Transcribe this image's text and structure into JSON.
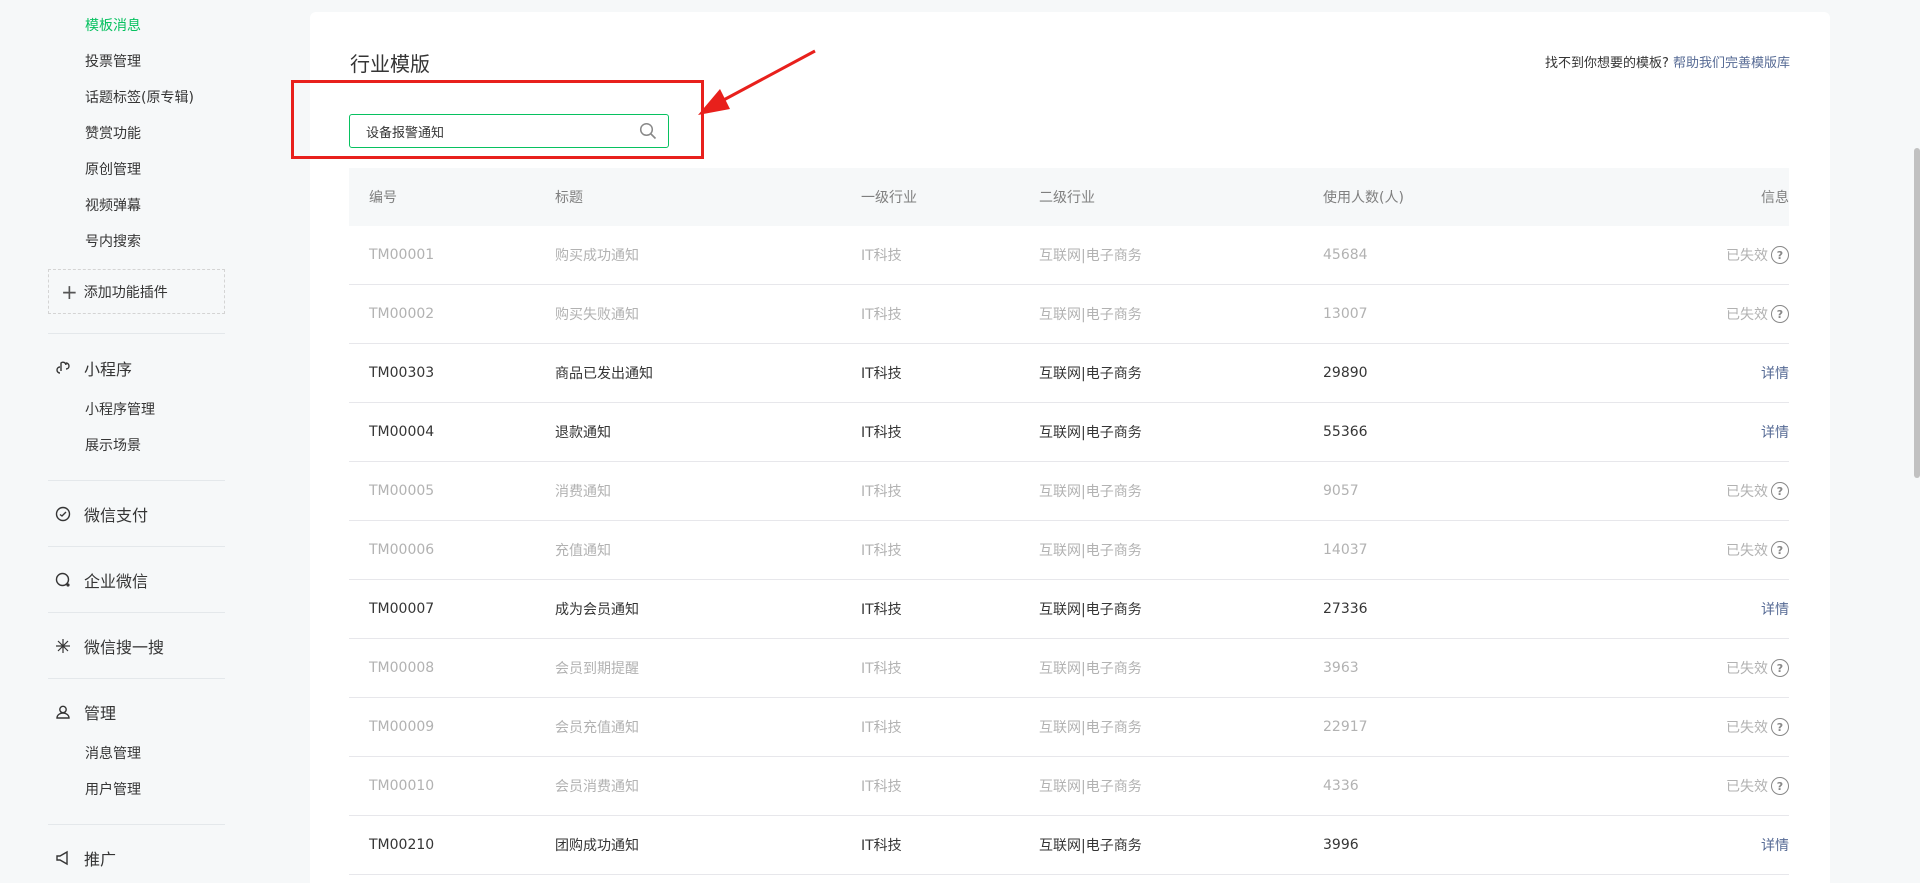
{
  "sidebar": {
    "top_items": [
      "模板消息",
      "投票管理",
      "话题标签(原专辑)",
      "赞赏功能",
      "原创管理",
      "视频弹幕",
      "号内搜索"
    ],
    "add_plugin": "添加功能插件",
    "mini_program": {
      "title": "小程序",
      "items": [
        "小程序管理",
        "展示场景"
      ]
    },
    "wechat_pay": {
      "title": "微信支付"
    },
    "work_wechat": {
      "title": "企业微信"
    },
    "wechat_search": {
      "title": "微信搜一搜"
    },
    "manage": {
      "title": "管理",
      "items": [
        "消息管理",
        "用户管理"
      ]
    },
    "promote": {
      "title": "推广"
    }
  },
  "main": {
    "title": "行业模版",
    "help_prefix": "找不到你想要的模板?",
    "help_link": "帮助我们完善模版库",
    "search_value": "设备报警通知"
  },
  "table": {
    "headers": [
      "编号",
      "标题",
      "一级行业",
      "二级行业",
      "使用人数(人)",
      "信息"
    ],
    "rows": [
      {
        "id": "TM00001",
        "title": "购买成功通知",
        "ind1": "IT科技",
        "ind2": "互联网|电子商务",
        "users": "45684",
        "info": "已失效"
      },
      {
        "id": "TM00002",
        "title": "购买失败通知",
        "ind1": "IT科技",
        "ind2": "互联网|电子商务",
        "users": "13007",
        "info": "已失效"
      },
      {
        "id": "TM00303",
        "title": "商品已发出通知",
        "ind1": "IT科技",
        "ind2": "互联网|电子商务",
        "users": "29890",
        "info": "详情"
      },
      {
        "id": "TM00004",
        "title": "退款通知",
        "ind1": "IT科技",
        "ind2": "互联网|电子商务",
        "users": "55366",
        "info": "详情"
      },
      {
        "id": "TM00005",
        "title": "消费通知",
        "ind1": "IT科技",
        "ind2": "互联网|电子商务",
        "users": "9057",
        "info": "已失效"
      },
      {
        "id": "TM00006",
        "title": "充值通知",
        "ind1": "IT科技",
        "ind2": "互联网|电子商务",
        "users": "14037",
        "info": "已失效"
      },
      {
        "id": "TM00007",
        "title": "成为会员通知",
        "ind1": "IT科技",
        "ind2": "互联网|电子商务",
        "users": "27336",
        "info": "详情"
      },
      {
        "id": "TM00008",
        "title": "会员到期提醒",
        "ind1": "IT科技",
        "ind2": "互联网|电子商务",
        "users": "3963",
        "info": "已失效"
      },
      {
        "id": "TM00009",
        "title": "会员充值通知",
        "ind1": "IT科技",
        "ind2": "互联网|电子商务",
        "users": "22917",
        "info": "已失效"
      },
      {
        "id": "TM00010",
        "title": "会员消费通知",
        "ind1": "IT科技",
        "ind2": "互联网|电子商务",
        "users": "4336",
        "info": "已失效"
      },
      {
        "id": "TM00210",
        "title": "团购成功通知",
        "ind1": "IT科技",
        "ind2": "互联网|电子商务",
        "users": "3996",
        "info": "详情"
      }
    ]
  },
  "colors": {
    "accent": "#07c160",
    "link": "#576b95",
    "annotation": "#e8201c"
  },
  "icons": {
    "mini_program": "link-icon",
    "wechat_pay": "pay-icon",
    "work_wechat": "chat-icon",
    "wechat_search": "sparkle-icon",
    "manage": "user-icon",
    "promote": "megaphone-icon",
    "search": "search-icon",
    "help": "question-icon"
  }
}
